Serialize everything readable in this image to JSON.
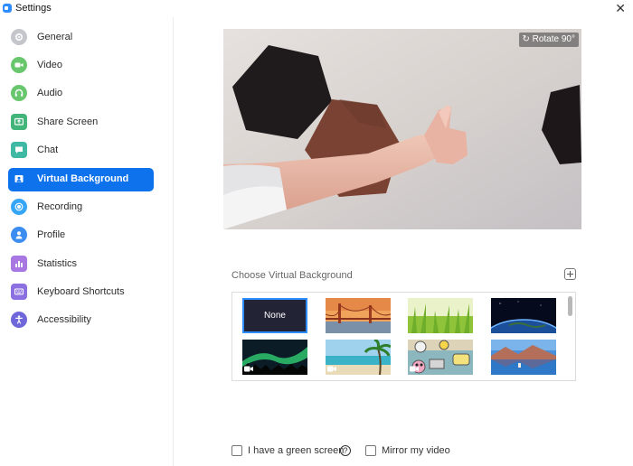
{
  "window": {
    "title": "Settings",
    "close_label": "✕"
  },
  "sidebar": {
    "items": [
      {
        "label": "General",
        "icon": "gear-icon",
        "color": "#c5c6cc"
      },
      {
        "label": "Video",
        "icon": "video-camera-icon",
        "color": "#68c76d"
      },
      {
        "label": "Audio",
        "icon": "headphones-icon",
        "color": "#68c76d"
      },
      {
        "label": "Share Screen",
        "icon": "share-screen-icon",
        "color": "#44b57a"
      },
      {
        "label": "Chat",
        "icon": "chat-bubble-icon",
        "color": "#3fb8a4"
      },
      {
        "label": "Virtual Background",
        "icon": "virtual-background-icon",
        "color": "#0e72ed",
        "active": true
      },
      {
        "label": "Recording",
        "icon": "record-icon",
        "color": "#35a5f5"
      },
      {
        "label": "Profile",
        "icon": "profile-icon",
        "color": "#3b8ef0"
      },
      {
        "label": "Statistics",
        "icon": "statistics-icon",
        "color": "#a877e2"
      },
      {
        "label": "Keyboard Shortcuts",
        "icon": "keyboard-icon",
        "color": "#8c6fe0"
      },
      {
        "label": "Accessibility",
        "icon": "accessibility-icon",
        "color": "#6e66d9"
      }
    ]
  },
  "preview": {
    "rotate_label": "Rotate 90°"
  },
  "virtual_background": {
    "label": "Choose Virtual Background",
    "thumbnails": [
      {
        "label": "None",
        "selected": true
      },
      {
        "name": "golden-gate-bridge"
      },
      {
        "name": "grass"
      },
      {
        "name": "earth-from-space"
      },
      {
        "name": "aurora",
        "video": true
      },
      {
        "name": "beach-palm",
        "video": true
      },
      {
        "name": "cartoon-animation",
        "video": true
      },
      {
        "name": "mountain-lake"
      }
    ]
  },
  "options": {
    "green_screen_label": "I have a green screen",
    "green_screen_checked": false,
    "help_label": "?",
    "mirror_label": "Mirror my video",
    "mirror_checked": false
  },
  "colors": {
    "accent": "#0e72ed",
    "selection_border": "#2d8cff"
  }
}
